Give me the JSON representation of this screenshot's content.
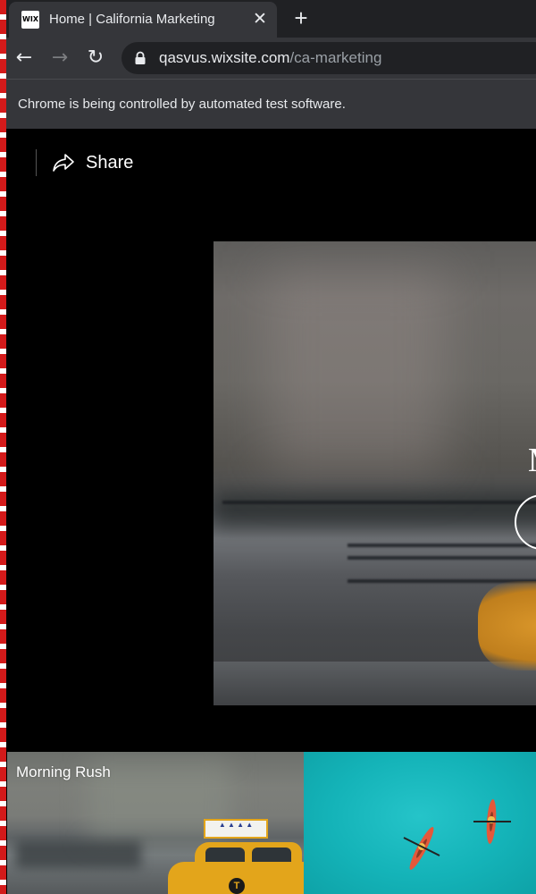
{
  "browser": {
    "tab": {
      "favicon_text": "WIX",
      "title": "Home | California Marketing",
      "close_symbol": "✕"
    },
    "new_tab_symbol": "+",
    "nav": {
      "back_symbol": "←",
      "forward_symbol": "→",
      "reload_symbol": "↻"
    },
    "address_bar": {
      "host": "qasvus.wixsite.com",
      "path": "/ca-marketing"
    },
    "infobar": {
      "message": "Chrome is being controlled by automated test software."
    }
  },
  "page": {
    "share": {
      "label": "Share",
      "icon": "share-arrow-icon"
    },
    "hero": {
      "title_fragment": "M",
      "play_icon": "play-circle-icon"
    },
    "videos": [
      {
        "title": "Morning Rush",
        "taxi_sign_text": "▲ ▲ ▲ ▲",
        "taxi_logo_text": "T"
      },
      {
        "title": ""
      }
    ]
  },
  "colors": {
    "browser_frame": "#202124",
    "browser_toolbar": "#35363a",
    "page_background": "#000000",
    "taxi_yellow": "#e3a51b",
    "water": "#14b3b8",
    "automation_stripe": "#d31a1a"
  }
}
